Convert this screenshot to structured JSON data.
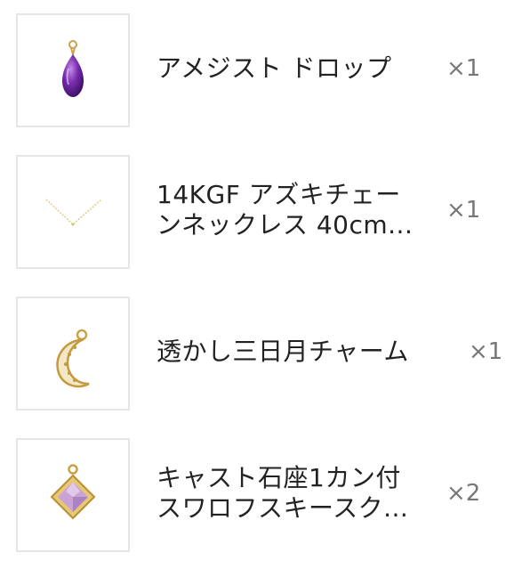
{
  "cart": {
    "items": [
      {
        "title_lines": [
          "アメジスト ドロップ"
        ],
        "quantity": "×1",
        "image_icon": "amethyst-drop-icon",
        "accent": "#7a2fb0"
      },
      {
        "title_lines": [
          "14KGF アズキチェー",
          "ンネックレス 40cm..."
        ],
        "quantity": "×1",
        "image_icon": "gold-chain-necklace-icon",
        "accent": "#d9c27a"
      },
      {
        "title_lines": [
          "透かし三日月チャーム"
        ],
        "quantity": "×1",
        "image_icon": "crescent-moon-charm-icon",
        "accent": "#c9a24a"
      },
      {
        "title_lines": [
          "キャスト石座1カン付",
          "スワロフスキースク..."
        ],
        "quantity": "×2",
        "image_icon": "square-crystal-charm-icon",
        "accent": "#b98ac6"
      }
    ]
  }
}
